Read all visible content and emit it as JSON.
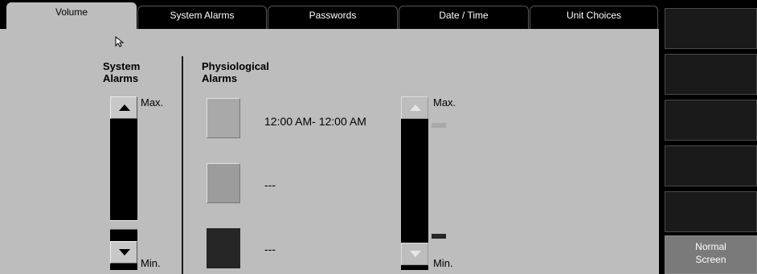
{
  "tabs": [
    {
      "label": "Volume",
      "active": true
    },
    {
      "label": "System Alarms",
      "active": false
    },
    {
      "label": "Passwords",
      "active": false
    },
    {
      "label": "Date / Time",
      "active": false
    },
    {
      "label": "Unit Choices",
      "active": false
    }
  ],
  "system_alarms": {
    "title_line1": "System",
    "title_line2": "Alarms",
    "max_label": "Max.",
    "min_label": "Min.",
    "volume_level": 0.1
  },
  "physiological_alarms": {
    "title_line1": "Physiological",
    "title_line2": "Alarms",
    "items": [
      {
        "text": "12:00 AM- 12:00 AM",
        "color": "#a9a9a9"
      },
      {
        "text": "---",
        "color": "#9c9c9c"
      },
      {
        "text": "---",
        "color": "#262626"
      }
    ],
    "max_label": "Max.",
    "min_label": "Min."
  },
  "side_buttons": [
    {
      "label": ""
    },
    {
      "label": ""
    },
    {
      "label": ""
    },
    {
      "label": ""
    },
    {
      "label": ""
    },
    {
      "label": "Normal Screen"
    }
  ],
  "colors": {
    "panel": "#bdbdbd",
    "background": "#000000",
    "accent_button": "#7a7a7a"
  }
}
